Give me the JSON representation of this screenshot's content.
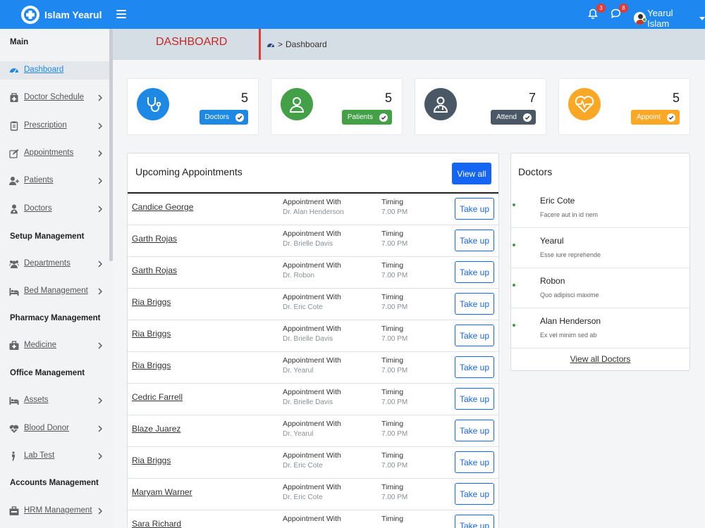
{
  "brand": {
    "name": "Islam Yearul"
  },
  "topbar": {
    "notifications_count": "3",
    "messages_count": "8",
    "user_name": "Yearul Islam"
  },
  "sidebar": {
    "sections": [
      {
        "heading": "Main",
        "items": [
          {
            "label": "Dashboard",
            "icon": "dashboard-icon",
            "active": true
          },
          {
            "label": "Doctor Schedule",
            "icon": "schedule-icon"
          },
          {
            "label": "Prescription",
            "icon": "prescription-icon"
          },
          {
            "label": "Appointments",
            "icon": "edit-icon"
          },
          {
            "label": "Patients",
            "icon": "user-plus-icon"
          },
          {
            "label": "Doctors",
            "icon": "doctor-icon"
          }
        ]
      },
      {
        "heading": "Setup Management",
        "items": [
          {
            "label": "Departments",
            "icon": "users-icon"
          },
          {
            "label": "Bed Management",
            "icon": "bed-icon"
          }
        ]
      },
      {
        "heading": "Pharmacy Management",
        "items": [
          {
            "label": "Medicine",
            "icon": "medkit-icon"
          }
        ]
      },
      {
        "heading": "Office Management",
        "items": [
          {
            "label": "Assets",
            "icon": "bed-icon"
          },
          {
            "label": "Blood Donor",
            "icon": "heartbeat-icon"
          },
          {
            "label": "Lab Test",
            "icon": "flask-icon"
          }
        ]
      },
      {
        "heading": "Accounts Management",
        "items": [
          {
            "label": "HRM Management",
            "icon": "hrm-icon"
          }
        ]
      }
    ]
  },
  "page": {
    "title": "DASHBOARD",
    "breadcrumb": "Dashboard"
  },
  "stats": [
    {
      "value": "5",
      "label": "Doctors",
      "color": "#1e88e5",
      "icon": "stethoscope-icon"
    },
    {
      "value": "5",
      "label": "Patients",
      "color": "#43a047",
      "icon": "patient-icon"
    },
    {
      "value": "7",
      "label": "Attend",
      "color": "#4a5866",
      "icon": "doctor-icon"
    },
    {
      "value": "5",
      "label": "Appoint",
      "color": "#f9a825",
      "icon": "heartbeat-icon"
    }
  ],
  "appointments": {
    "title": "Upcoming Appointments",
    "view_all": "View all",
    "rows": [
      {
        "name": "Candice George",
        "with_label": "Appointment With",
        "doctor": "Dr. Alan Henderson",
        "timing_label": "Timing",
        "time": "7.00 PM",
        "action": "Take up"
      },
      {
        "name": "Garth Rojas",
        "with_label": "Appointment With",
        "doctor": "Dr. Brielle Davis",
        "timing_label": "Timing",
        "time": "7.00 PM",
        "action": "Take up"
      },
      {
        "name": "Garth Rojas",
        "with_label": "Appointment With",
        "doctor": "Dr. Robon",
        "timing_label": "Timing",
        "time": "7.00 PM",
        "action": "Take up"
      },
      {
        "name": "Ria Briggs",
        "with_label": "Appointment With",
        "doctor": "Dr. Eric Cote",
        "timing_label": "Timing",
        "time": "7.00 PM",
        "action": "Take up"
      },
      {
        "name": "Ria Briggs",
        "with_label": "Appointment With",
        "doctor": "Dr. Brielle Davis",
        "timing_label": "Timing",
        "time": "7.00 PM",
        "action": "Take up"
      },
      {
        "name": "Ria Briggs",
        "with_label": "Appointment With",
        "doctor": "Dr. Yearul",
        "timing_label": "Timing",
        "time": "7.00 PM",
        "action": "Take up"
      },
      {
        "name": "Cedric Farrell",
        "with_label": "Appointment With",
        "doctor": "Dr. Brielle Davis",
        "timing_label": "Timing",
        "time": "7.00 PM",
        "action": "Take up"
      },
      {
        "name": "Blaze Juarez",
        "with_label": "Appointment With",
        "doctor": "Dr. Yearul",
        "timing_label": "Timing",
        "time": "7.00 PM",
        "action": "Take up"
      },
      {
        "name": "Ria Briggs",
        "with_label": "Appointment With",
        "doctor": "Dr. Eric Cote",
        "timing_label": "Timing",
        "time": "7.00 PM",
        "action": "Take up"
      },
      {
        "name": "Maryam Warner",
        "with_label": "Appointment With",
        "doctor": "Dr. Eric Cote",
        "timing_label": "Timing",
        "time": "7.00 PM",
        "action": "Take up"
      },
      {
        "name": "Sara Richard",
        "with_label": "Appointment With",
        "doctor": "",
        "timing_label": "Timing",
        "time": "",
        "action": "Take up"
      }
    ]
  },
  "doctors": {
    "title": "Doctors",
    "list": [
      {
        "name": "Eric Cote",
        "desc": "Facere aut in id nem"
      },
      {
        "name": "Yearul",
        "desc": "Esse iure reprehende"
      },
      {
        "name": "Robon",
        "desc": "Quo adipisci maxime"
      },
      {
        "name": "Alan Henderson",
        "desc": "Ex vel minim sed ab"
      }
    ],
    "view_all": "View all Doctors"
  }
}
